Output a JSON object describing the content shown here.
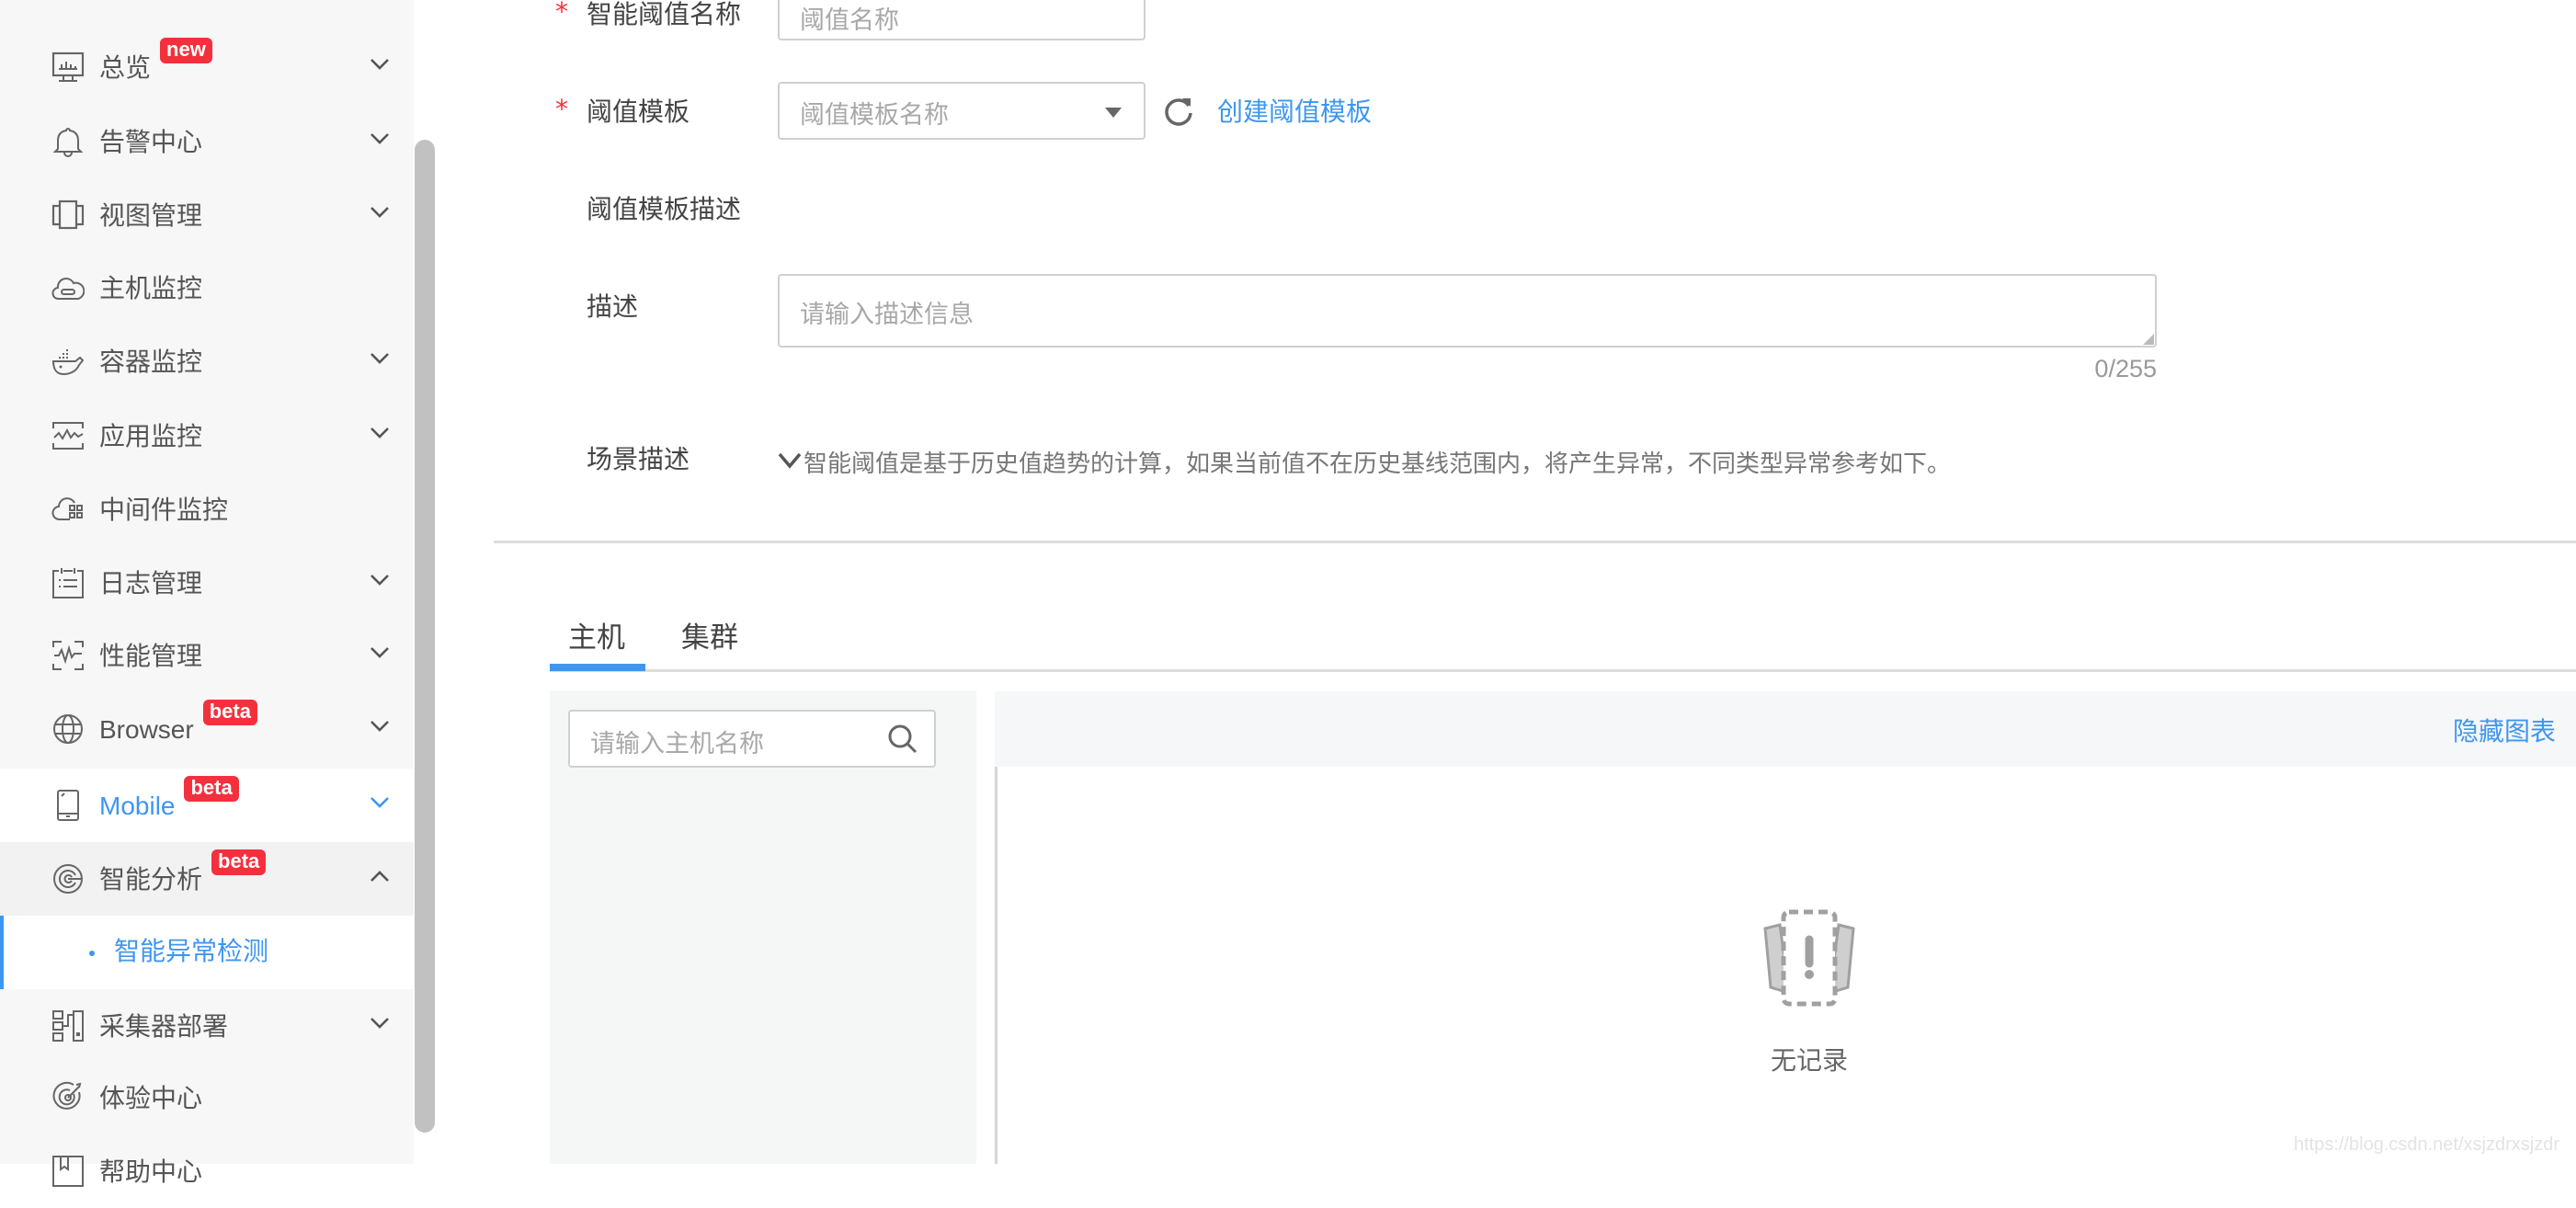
{
  "sidebar": {
    "items": [
      {
        "label": "总览",
        "icon": "monitor-chart-icon",
        "badge": "new",
        "chevron": "down"
      },
      {
        "label": "告警中心",
        "icon": "bell-icon",
        "chevron": "down"
      },
      {
        "label": "视图管理",
        "icon": "view-panels-icon",
        "chevron": "down"
      },
      {
        "label": "主机监控",
        "icon": "cloud-host-icon"
      },
      {
        "label": "容器监控",
        "icon": "docker-whale-icon",
        "chevron": "down"
      },
      {
        "label": "应用监控",
        "icon": "app-pulse-icon",
        "chevron": "down"
      },
      {
        "label": "中间件监控",
        "icon": "cloud-grid-icon"
      },
      {
        "label": "日志管理",
        "icon": "log-list-icon",
        "chevron": "down"
      },
      {
        "label": "性能管理",
        "icon": "performance-pulse-icon",
        "chevron": "down"
      },
      {
        "label": "Browser",
        "icon": "globe-icon",
        "badge": "beta",
        "chevron": "down"
      },
      {
        "label": "Mobile",
        "icon": "mobile-icon",
        "badge": "beta",
        "chevron": "down"
      },
      {
        "label": "智能分析",
        "icon": "radar-icon",
        "badge": "beta",
        "chevron": "up"
      },
      {
        "label": "采集器部署",
        "icon": "collector-icon",
        "chevron": "down"
      },
      {
        "label": "体验中心",
        "icon": "target-icon"
      },
      {
        "label": "帮助中心",
        "icon": "help-book-icon"
      }
    ],
    "sub_item": {
      "label": "智能异常检测"
    }
  },
  "form": {
    "name": {
      "label": "智能阈值名称",
      "required_mark": "*",
      "placeholder": "阈值名称"
    },
    "template": {
      "label": "阈值模板",
      "required_mark": "*",
      "placeholder": "阈值模板名称",
      "create_link": "创建阈值模板"
    },
    "template_desc": {
      "label": "阈值模板描述"
    },
    "description": {
      "label": "描述",
      "placeholder": "请输入描述信息",
      "counter": "0/255"
    },
    "scenario": {
      "label": "场景描述",
      "text": "智能阈值是基于历史值趋势的计算，如果当前值不在历史基线范围内，将产生异常，不同类型异常参考如下。"
    }
  },
  "tabs": [
    {
      "label": "主机",
      "active": true
    },
    {
      "label": "集群",
      "active": false
    }
  ],
  "host_search": {
    "placeholder": "请输入主机名称"
  },
  "chart_panel": {
    "hide_chart_link": "隐藏图表",
    "empty_text": "无记录"
  },
  "watermark": "https://blog.csdn.net/xsjzdrxsjzdr",
  "colors": {
    "accent": "#3e96f0",
    "badge": "#f5303d",
    "required": "#f5303d"
  }
}
